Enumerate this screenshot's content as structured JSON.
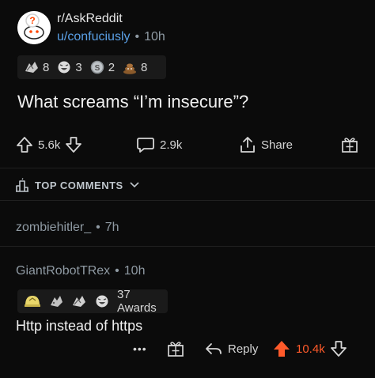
{
  "post": {
    "subreddit": "r/AskReddit",
    "author": "u/confuciusly",
    "age": "10h",
    "separator": "•",
    "awards": [
      {
        "icon": "hands-award-icon",
        "count": "8"
      },
      {
        "icon": "laughing-face-award-icon",
        "count": "3"
      },
      {
        "icon": "silver-coin-award-icon",
        "count": "2"
      },
      {
        "icon": "poop-award-icon",
        "count": "8"
      }
    ],
    "title": "What screams “I’m insecure”?",
    "upvotes": "5.6k",
    "comments": "2.9k",
    "share_label": "Share"
  },
  "sort": {
    "label": "TOP COMMENTS"
  },
  "comments": [
    {
      "author": "zombiehitler_",
      "separator": "•",
      "age": "7h"
    },
    {
      "author": "GiantRobotTRex",
      "separator": "•",
      "age": "10h",
      "awards_label": "37 Awards",
      "award_icons": [
        "helmet-award-icon",
        "wholesome-award-icon",
        "hands-award-icon",
        "laughing-face-award-icon"
      ],
      "body": "Http instead of https",
      "more": "•••",
      "reply_label": "Reply",
      "score": "10.4k"
    }
  ],
  "colors": {
    "background": "#0b0b0b",
    "link_blue": "#5aa0e6",
    "upvote_orange": "#ff5a2a",
    "muted": "#8f9aa3"
  }
}
